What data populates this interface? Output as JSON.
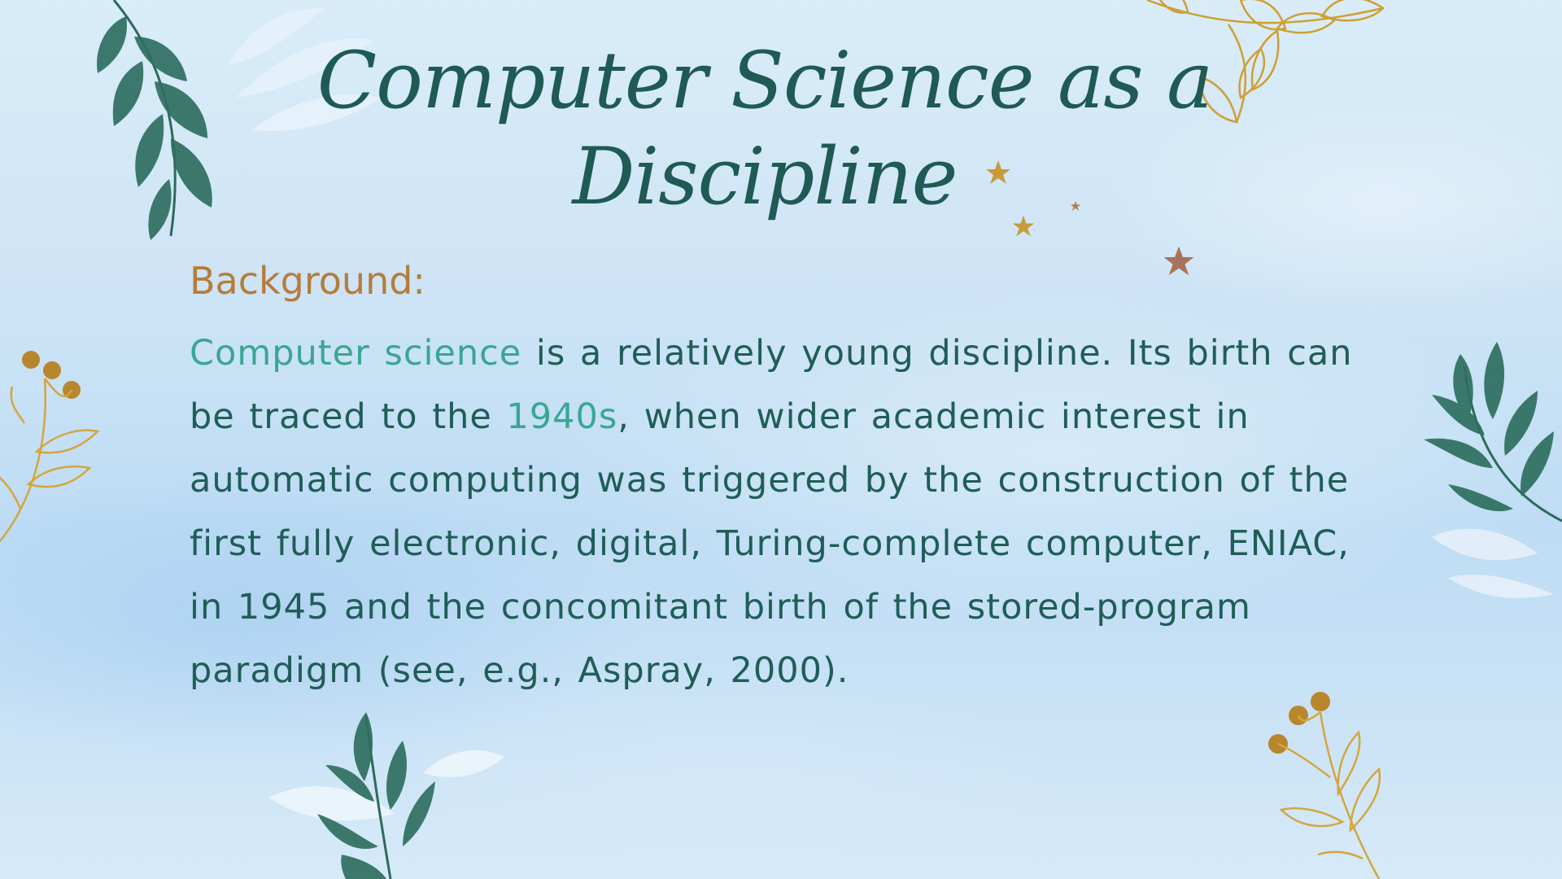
{
  "slide": {
    "title": "Computer Science as a Discipline",
    "subtitle": "Background:",
    "paragraph": {
      "highlight_1": "Computer science",
      "text_1": " is a relatively young discipline. Its birth can be traced to the ",
      "highlight_2": "1940s",
      "text_2": ", when wider academic interest in automatic computing was triggered by the construction of the first fully electronic, digital, Turing-complete computer, ENIAC, in 1945 and the concomitant birth of the stored-program paradigm (see, e.g., Aspray, 2000)."
    }
  },
  "colors": {
    "title": "#1f5a55",
    "subtitle": "#b57d3a",
    "body": "#1f5e57",
    "highlight": "#3aa693",
    "leaf": "#2e6b5f",
    "gold": "#c9982f"
  },
  "decorations": {
    "icons": [
      "green-leaf-branch-icon",
      "gold-leaf-branch-icon",
      "gold-berry-branch-icon",
      "gold-star-icon"
    ]
  }
}
